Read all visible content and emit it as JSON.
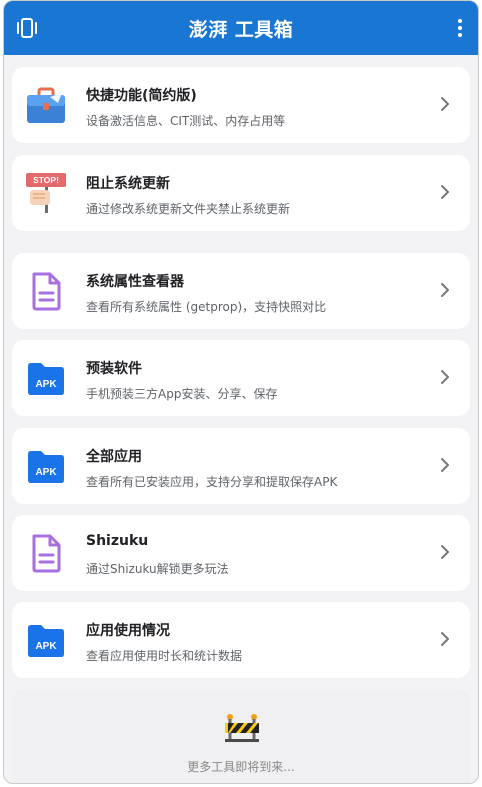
{
  "app": {
    "title": "澎湃 工具箱",
    "accent": "#1976d2"
  },
  "header": {
    "left_icon": "vibrate-phone-icon",
    "right_icon": "more-vert-icon"
  },
  "cards": [
    {
      "icon": "briefcase-icon",
      "title": "快捷功能(简约版)",
      "subtitle": "设备激活信息、CIT测试、内存占用等"
    },
    {
      "icon": "stop-sign-hand-icon",
      "title": "阻止系统更新",
      "subtitle": "通过修改系统更新文件夹禁止系统更新"
    },
    {
      "icon": "document-icon",
      "title": "系统属性查看器",
      "subtitle": "查看所有系统属性 (getprop)，支持快照对比"
    },
    {
      "icon": "apk-folder-icon",
      "title": "预装软件",
      "subtitle": "手机预装三方App安装、分享、保存"
    },
    {
      "icon": "apk-folder-icon",
      "title": "全部应用",
      "subtitle": "查看所有已安装应用，支持分享和提取保存APK"
    },
    {
      "icon": "document-icon",
      "title": "Shizuku",
      "subtitle": "通过Shizuku解锁更多玩法"
    },
    {
      "icon": "apk-folder-icon",
      "title": "应用使用情况",
      "subtitle": "查看应用使用时长和统计数据"
    }
  ],
  "icon_texts": {
    "stop": "STOP!",
    "apk": "APK"
  },
  "footer": {
    "icon": "construction-barrier-icon",
    "text": "更多工具即将到来..."
  }
}
